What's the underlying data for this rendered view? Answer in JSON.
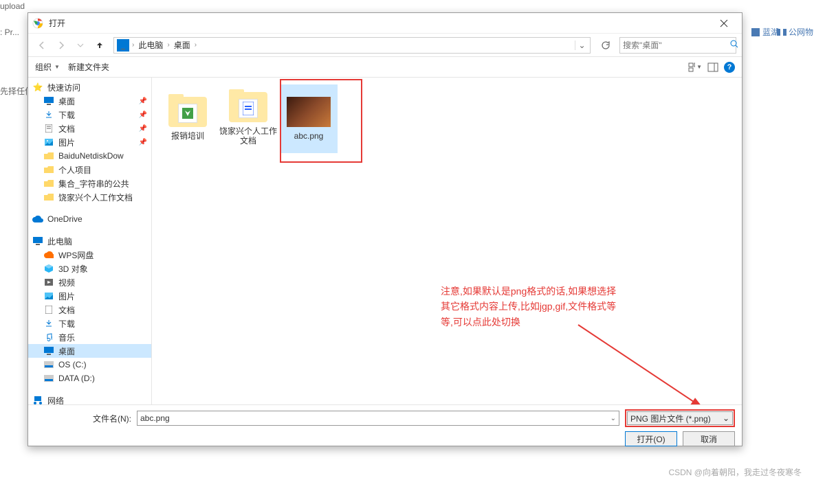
{
  "background": {
    "upload": "upload",
    "pr": ": Pr...",
    "select": "先择任何文",
    "lanhu": "蓝湖",
    "gongwang": "公网物"
  },
  "dialog": {
    "title": "打开",
    "breadcrumb": {
      "item1": "此电脑",
      "item2": "桌面"
    },
    "search_placeholder": "搜索\"桌面\"",
    "toolbar": {
      "organize": "组织",
      "newfolder": "新建文件夹"
    }
  },
  "sidebar": {
    "quickaccess": "快速访问",
    "desktop": "桌面",
    "downloads": "下载",
    "documents": "文档",
    "pictures": "图片",
    "baidu": "BaiduNetdiskDow",
    "personal": "个人项目",
    "jihe": "集合_字符串的公共",
    "raojiaxing": "饶家兴个人工作文档",
    "onedrive": "OneDrive",
    "thispc": "此电脑",
    "wps": "WPS网盘",
    "threed": "3D 对象",
    "videos": "视频",
    "pictures2": "图片",
    "documents2": "文档",
    "downloads2": "下载",
    "music": "音乐",
    "desktop2": "桌面",
    "osc": "OS (C:)",
    "datad": "DATA (D:)",
    "network": "网络"
  },
  "files": {
    "folder1": "报销培训",
    "folder2": "饶家兴个人工作文档",
    "file1": "abc.png"
  },
  "annotation": {
    "line1": "注意,如果默认是png格式的话,如果想选择",
    "line2": "其它格式内容上传,比如jgp,gif,文件格式等",
    "line3": "等,可以点此处切换"
  },
  "footer": {
    "filename_label": "文件名(N):",
    "filename_value": "abc.png",
    "filetype": "PNG 图片文件 (*.png)",
    "open_btn": "打开(O)",
    "cancel_btn": "取消"
  },
  "watermark": "CSDN @向着朝阳，我走过冬夜寒冬"
}
